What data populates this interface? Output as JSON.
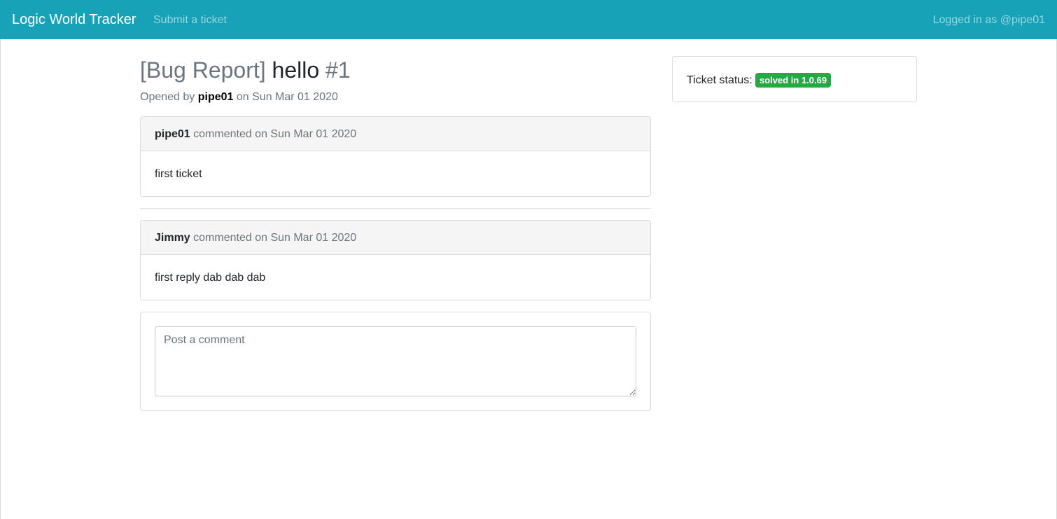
{
  "navbar": {
    "brand": "Logic World Tracker",
    "submit_link": "Submit a ticket",
    "logged_in": "Logged in as @pipe01"
  },
  "ticket": {
    "category": "[Bug Report]",
    "title": "hello",
    "number": "#1",
    "opened_prefix": "Opened by",
    "author": "pipe01",
    "opened_suffix": "on Sun Mar 01 2020"
  },
  "comments": [
    {
      "author": "pipe01",
      "meta": "commented on Sun Mar 01 2020",
      "body": "first ticket"
    },
    {
      "author": "Jimmy",
      "meta": "commented on Sun Mar 01 2020",
      "body": "first reply dab dab dab"
    }
  ],
  "comment_form": {
    "placeholder": "Post a comment"
  },
  "status": {
    "label": "Ticket status:",
    "badge": "solved in 1.0.69",
    "badge_color": "#28a745"
  },
  "colors": {
    "navbar": "#17a2b8"
  }
}
